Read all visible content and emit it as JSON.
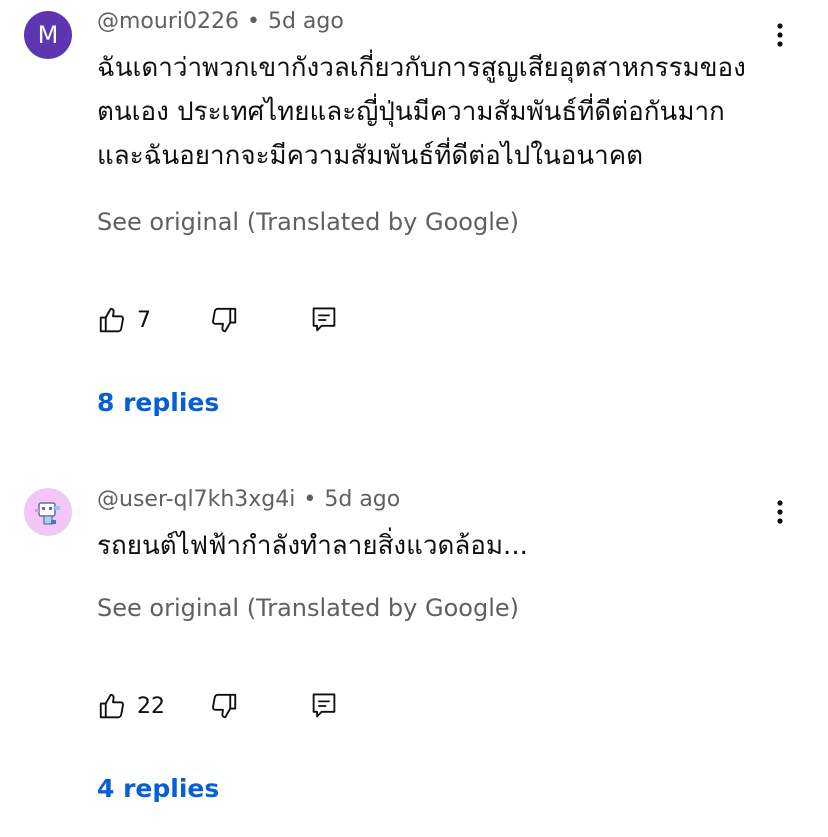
{
  "comments": [
    {
      "avatar_letter": "M",
      "avatar_color": "#5e35b1",
      "username": "@mouri0226",
      "separator": "•",
      "time": "5d ago",
      "text_lines": [
        "ฉันเดาว่าพวกเขากังวลเกี่ยวกับการสูญเสียอุตสาหกรรมของ",
        "ตนเอง ประเทศไทยและญี่ปุ่นมีความสัมพันธ์ที่ดีต่อกันมาก",
        "และฉันอยากจะมีความสัมพันธ์ที่ดีต่อไปในอนาคต"
      ],
      "see_original": "See original (Translated by Google)",
      "likes": "7",
      "replies": "8 replies"
    },
    {
      "avatar_icon": "robot-avatar-icon",
      "avatar_color": "#f2c6f5",
      "username": "@user-ql7kh3xg4i",
      "separator": "•",
      "time": "5d ago",
      "text_lines": [
        "รถยนต์ไฟฟ้ากำลังทำลายสิ่งแวดล้อม..."
      ],
      "see_original": "See original (Translated by Google)",
      "likes": "22",
      "replies": "4 replies"
    }
  ],
  "colors": {
    "link": "#065fd4",
    "secondary_text": "#606060"
  }
}
